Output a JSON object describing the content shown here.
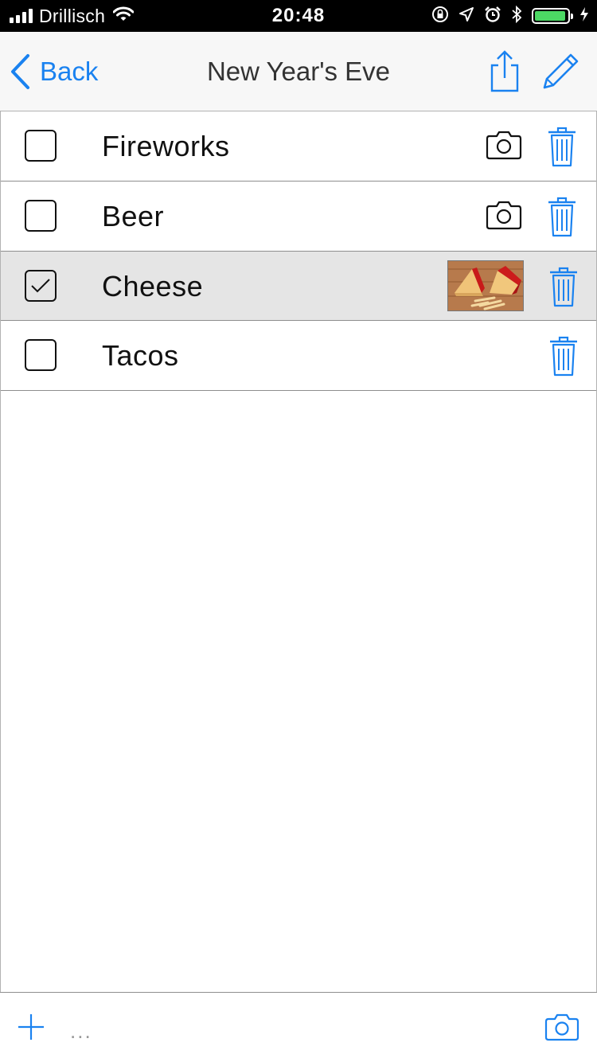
{
  "status_bar": {
    "carrier": "Drillisch",
    "time": "20:48",
    "battery_level": 0.95
  },
  "nav": {
    "back_label": "Back",
    "title": "New Year's Eve",
    "accent_color": "#1a82f0"
  },
  "items": [
    {
      "label": "Fireworks",
      "checked": false,
      "attachment": "camera-icon"
    },
    {
      "label": "Beer",
      "checked": false,
      "attachment": "camera-icon"
    },
    {
      "label": "Cheese",
      "checked": true,
      "attachment": "photo-thumbnail"
    },
    {
      "label": "Tacos",
      "checked": false,
      "attachment": "none"
    }
  ],
  "toolbar": {
    "more_label": "..."
  }
}
